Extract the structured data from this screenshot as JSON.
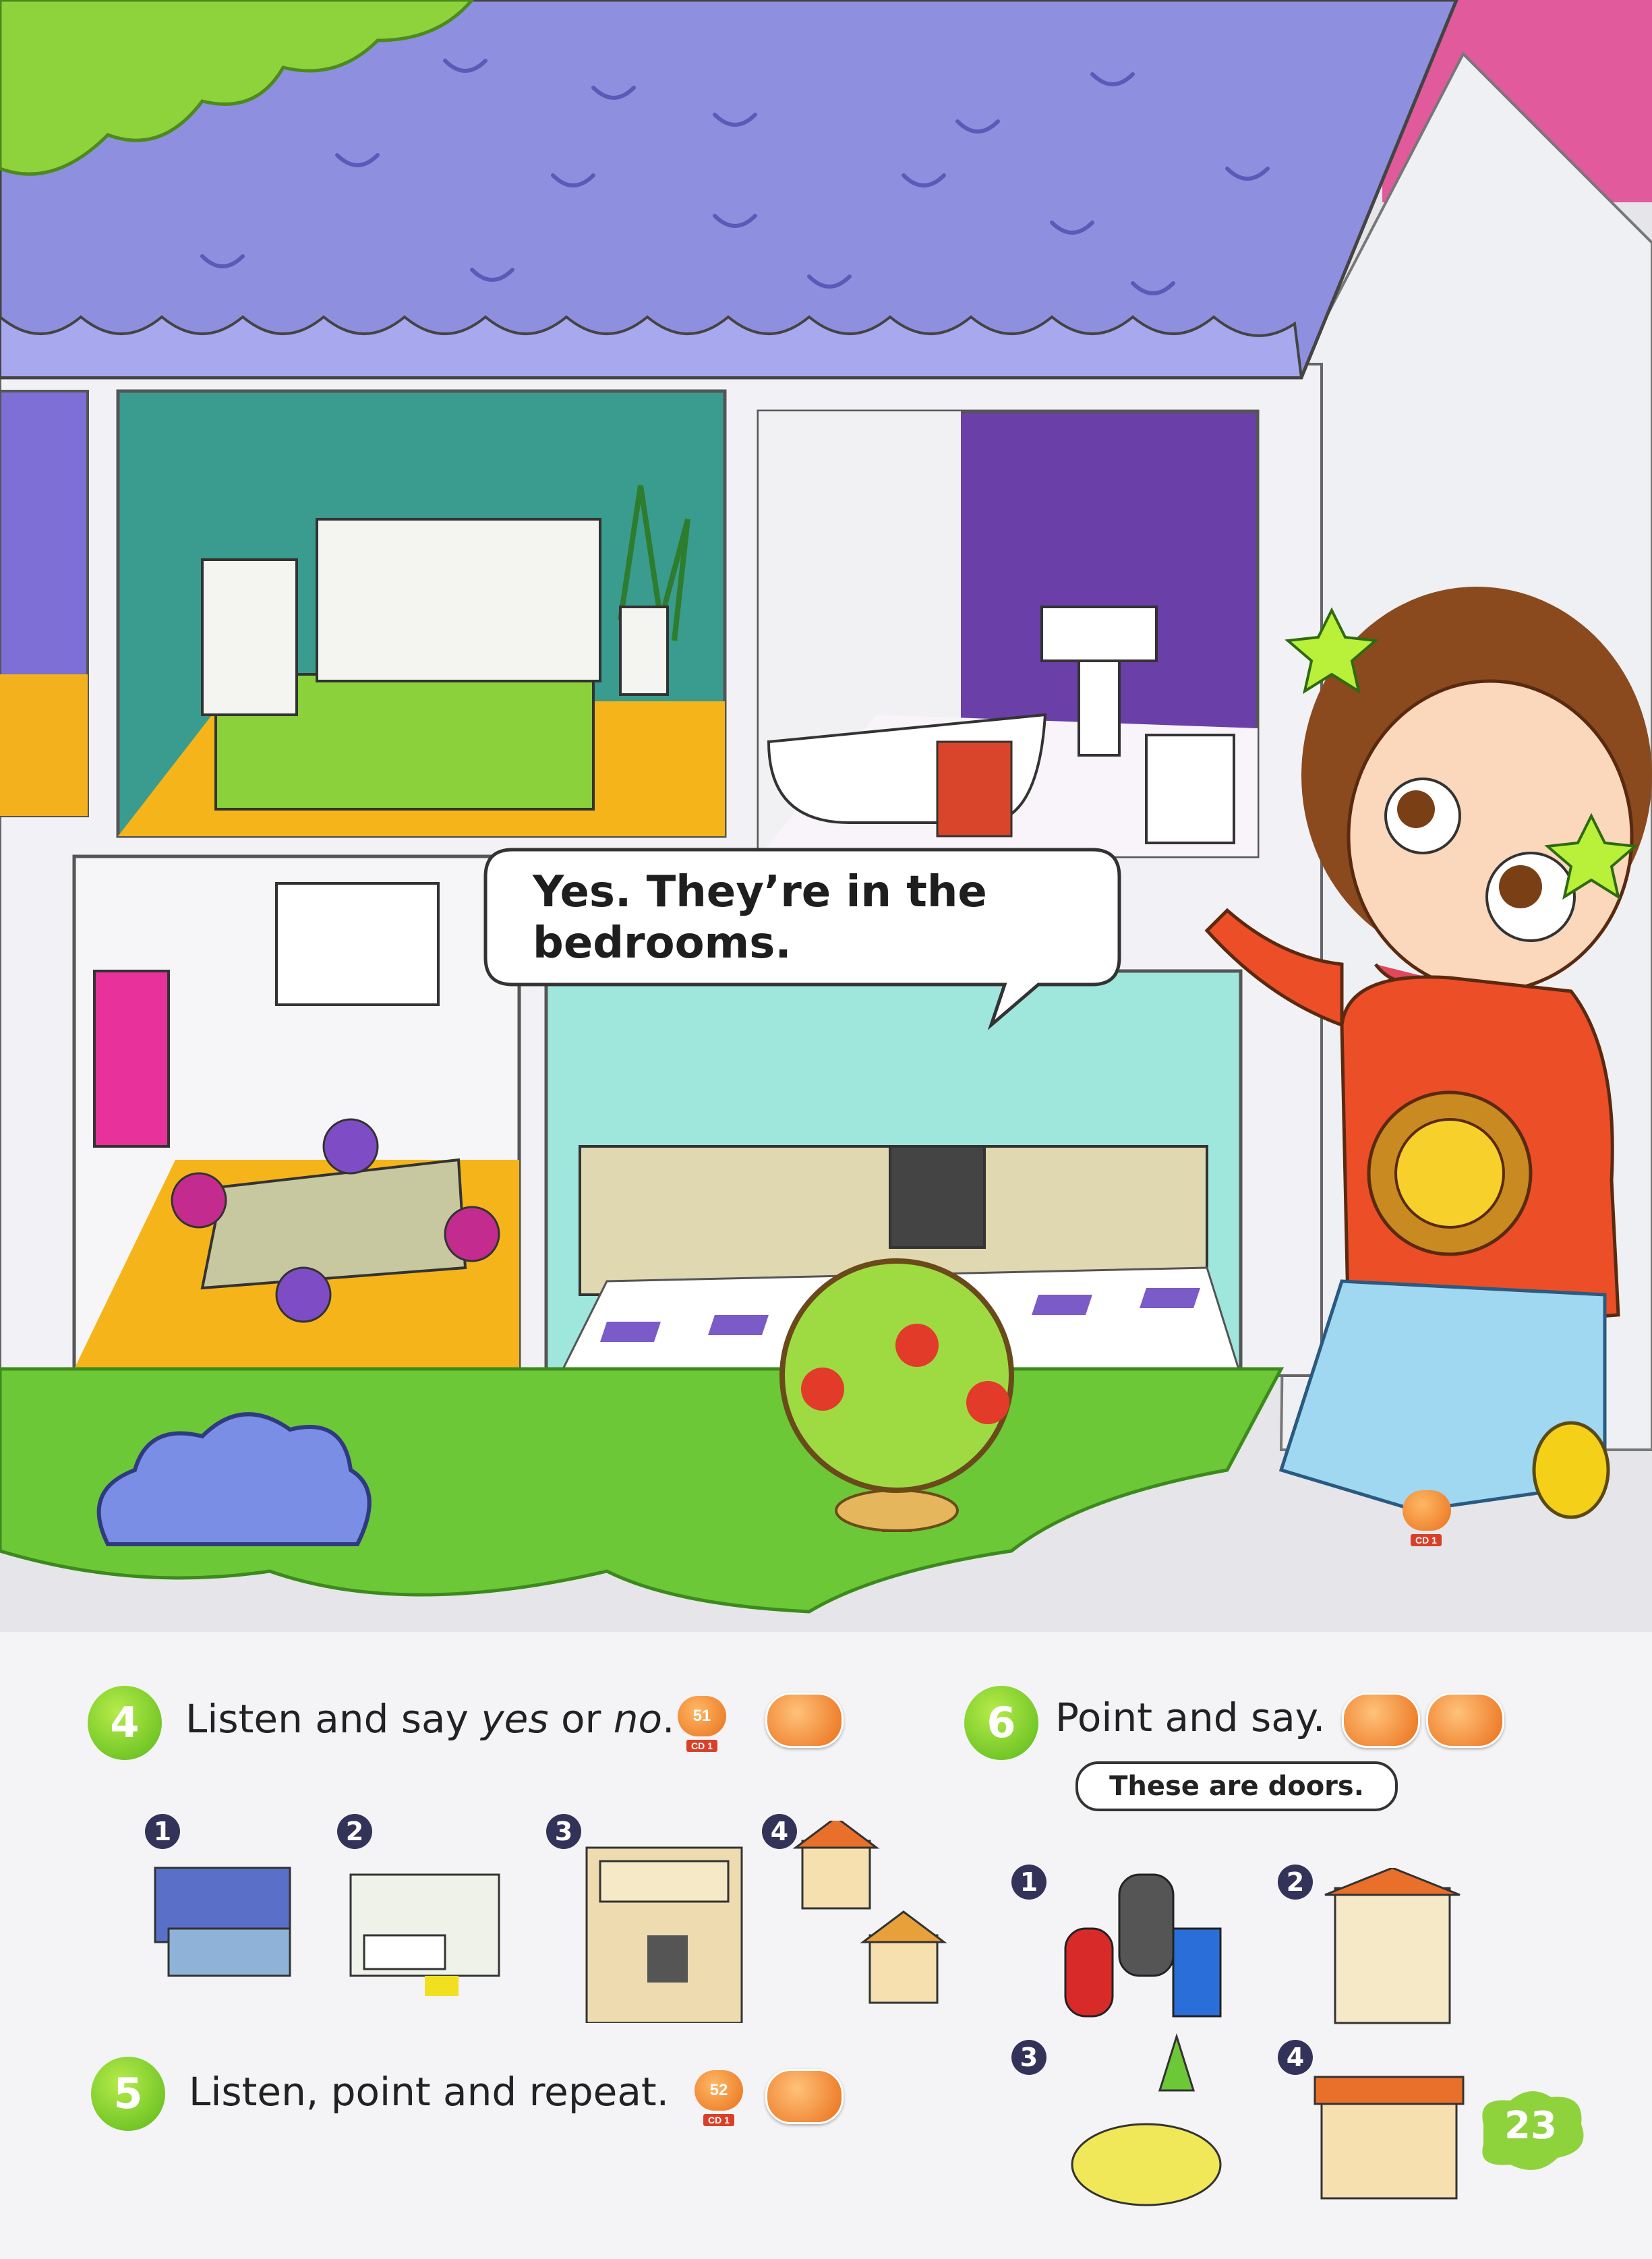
{
  "speech_bubble": {
    "line1": "Yes. They’re in the",
    "line2": "bedrooms."
  },
  "audio_track_main": {
    "number": "",
    "disc": "CD 1"
  },
  "exercise_4": {
    "number": "4",
    "text_before": "Listen and say ",
    "text_yes": "yes",
    "text_or": " or ",
    "text_no": "no",
    "text_end": ".",
    "audio_track": "51",
    "audio_disc": "CD 1",
    "items": [
      "1",
      "2",
      "3",
      "4"
    ]
  },
  "exercise_5": {
    "number": "5",
    "text": "Listen, point and repeat.",
    "audio_track": "52",
    "audio_disc": "CD 1"
  },
  "exercise_6": {
    "number": "6",
    "text": "Point and say.",
    "bubble": "These are doors.",
    "items": [
      "1",
      "2",
      "3",
      "4"
    ]
  },
  "page_number": "23",
  "colors": {
    "roof": "#8f8fe0",
    "grass": "#6cc837",
    "accent_green": "#7fd030",
    "badge_orange": "#ec7a24"
  }
}
